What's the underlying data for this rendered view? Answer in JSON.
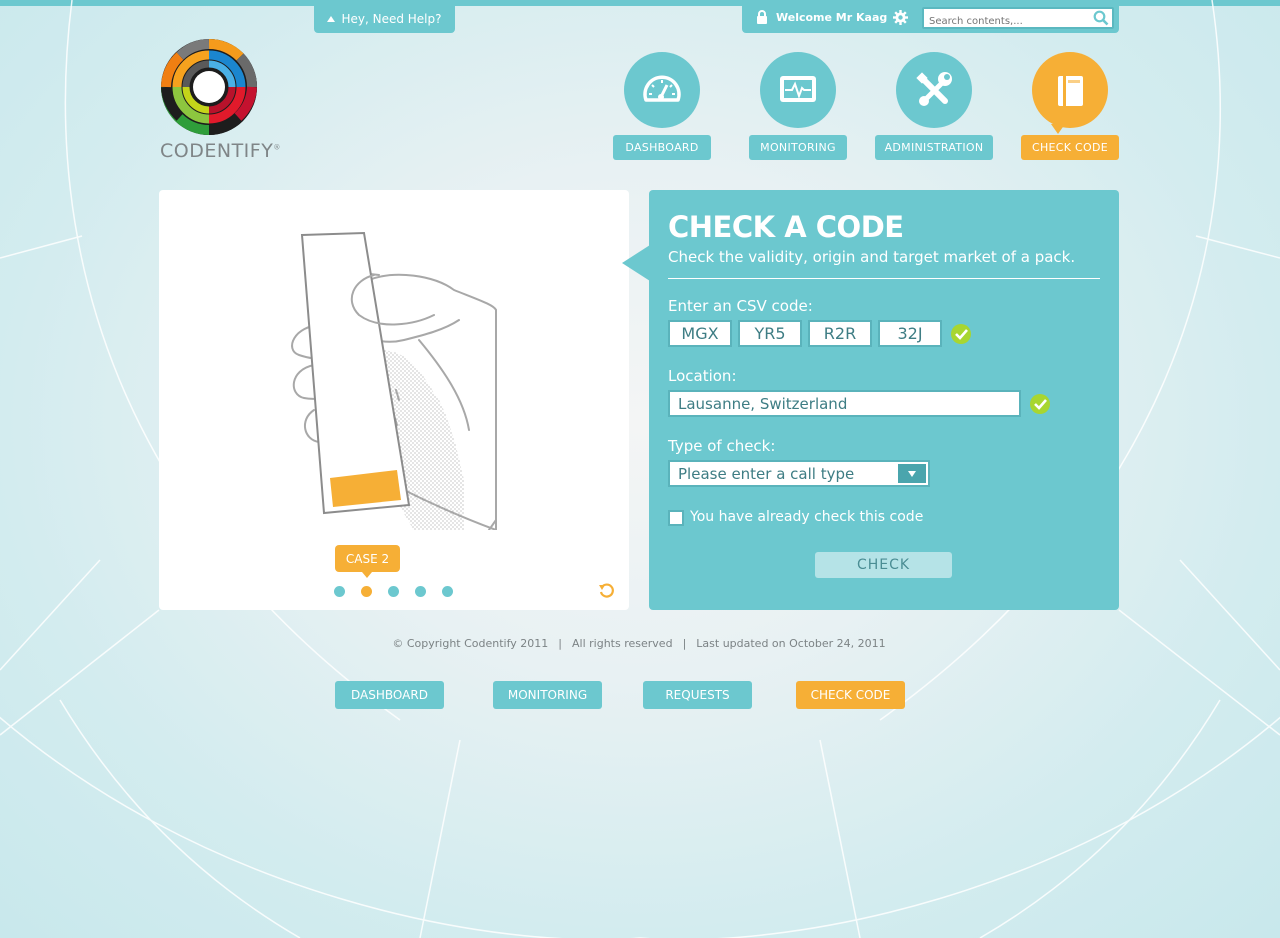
{
  "help": {
    "label": "Hey, Need Help?"
  },
  "user": {
    "welcome": "Welcome Mr Kaag",
    "search_placeholder": "Search contents,..."
  },
  "brand": {
    "name": "CODENTIFY",
    "mark": "®"
  },
  "nav": [
    {
      "label": "DASHBOARD",
      "icon": "gauge-icon",
      "active": false
    },
    {
      "label": "MONITORING",
      "icon": "monitor-pulse-icon",
      "active": false
    },
    {
      "label": "ADMINISTRATION",
      "icon": "tools-icon",
      "active": false
    },
    {
      "label": "CHECK CODE",
      "icon": "book-icon",
      "active": true
    }
  ],
  "illustration": {
    "case_label": "CASE 2",
    "slides": 5,
    "current_slide": 2
  },
  "form": {
    "title": "CHECK A CODE",
    "subtitle": "Check the validity, origin and target market of a pack.",
    "csv_label": "Enter an CSV code:",
    "csv_codes": [
      "MGX",
      "YR5",
      "R2R",
      "32J"
    ],
    "location_label": "Location:",
    "location_value": "Lausanne, Switzerland",
    "type_label": "Type of check:",
    "type_value": "Please enter a call type",
    "already_checked_label": "You have already check this code",
    "submit_label": "CHECK"
  },
  "footer": {
    "copyright": "© Copyright Codentify 2011",
    "rights": "All rights reserved",
    "updated": "Last updated on October 24, 2011",
    "links": [
      {
        "label": "DASHBOARD",
        "active": false
      },
      {
        "label": "MONITORING",
        "active": false
      },
      {
        "label": "REQUESTS",
        "active": false
      },
      {
        "label": "CHECK CODE",
        "active": true
      }
    ]
  },
  "colors": {
    "accent": "#6cc8cf",
    "active": "#f6af36",
    "valid": "#a8d630"
  }
}
